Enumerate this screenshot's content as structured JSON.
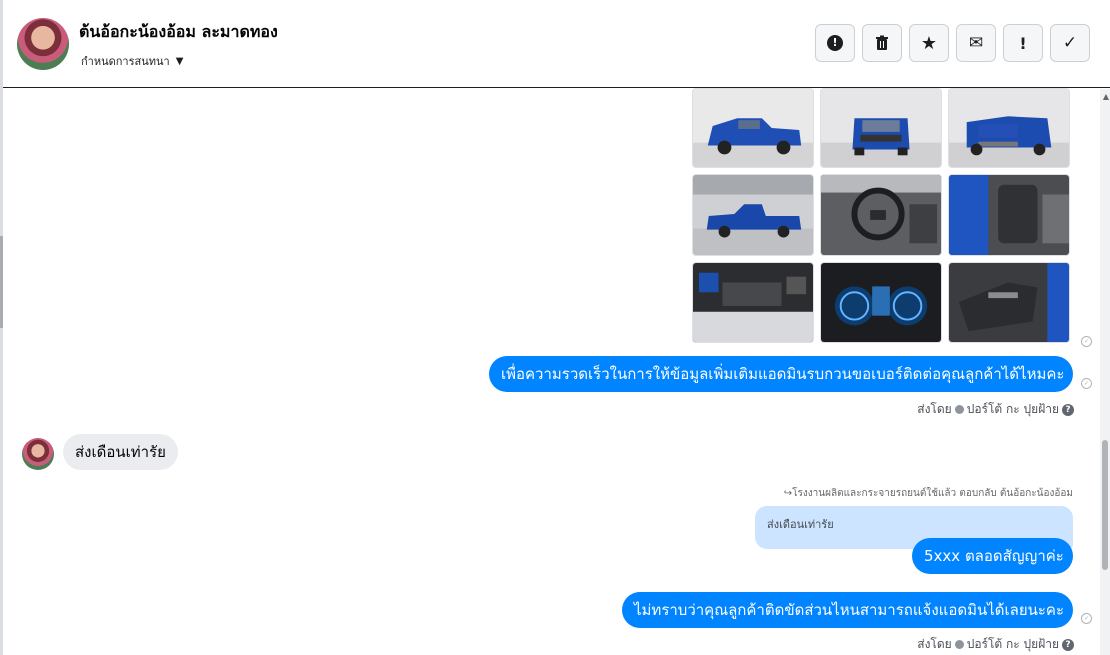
{
  "header": {
    "name": "ต้นอ้อกะน้องอ้อม ละมาดทอง",
    "subtitle": "กำหนดการสนทนา",
    "caret_icon": "caret-down-icon",
    "toolbar": [
      {
        "icon": "alert-circle-icon",
        "glyph": "!"
      },
      {
        "icon": "trash-icon",
        "glyph": "🗑"
      },
      {
        "icon": "star-icon",
        "glyph": "★"
      },
      {
        "icon": "envelope-icon",
        "glyph": "✉"
      },
      {
        "icon": "exclamation-icon",
        "glyph": "!"
      },
      {
        "icon": "check-icon",
        "glyph": "✓"
      }
    ]
  },
  "messages": {
    "out1": "เพื่อความรวดเร็วในการให้ข้อมูลเพิ่มเติมแอดมินรบกวนขอเบอร์ติดต่อคุณลูกค้าได้ไหมคะ",
    "sent_by_1": {
      "prefix": "ส่งโดย",
      "name": "ปอร์โต้ กะ ปุยฝ้าย"
    },
    "in1": "ส่งเดือนเท่ารัย",
    "reply_meta": "↪โรงงานผลิตและกระจายรถยนต์ใช้แล้ว ตอบกลับ ต้นอ้อกะน้องอ้อม",
    "quoted": "ส่งเดือนเท่ารัย",
    "out2": "5xxx ตลอดสัญญาค่ะ",
    "out3": "ไม่ทราบว่าคุณลูกค้าติดขัดส่วนไหนสามารถแจ้งแอดมินได้เลยนะคะ",
    "sent_by_2": {
      "prefix": "ส่งโดย",
      "name": "ปอร์โต้ กะ ปุยฝ้าย"
    }
  },
  "photos": [
    "pickup-front-left",
    "pickup-front",
    "pickup-rear",
    "pickup-side",
    "steering-wheel",
    "driver-seat",
    "engine-bay",
    "instrument-cluster",
    "door-panel"
  ],
  "colors": {
    "accent": "#0084ff",
    "incoming": "#ebecf0",
    "quoted": "#cce4ff"
  }
}
